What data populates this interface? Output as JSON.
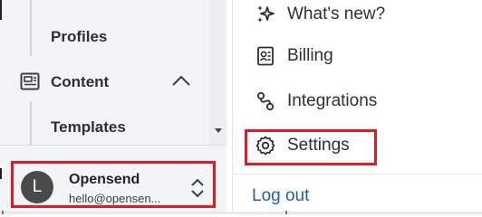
{
  "sidebar": {
    "items": [
      {
        "label": "Profiles",
        "icon": null
      },
      {
        "label": "Content",
        "icon": "content-icon",
        "expanded": true
      },
      {
        "label": "Templates",
        "icon": null
      }
    ],
    "user": {
      "avatar_initial": "L",
      "name": "Opensend",
      "email": "hello@opensen..."
    }
  },
  "menu": {
    "items": [
      {
        "label": "What's new?",
        "icon": "sparkles-icon"
      },
      {
        "label": "Billing",
        "icon": "billing-icon"
      },
      {
        "label": "Integrations",
        "icon": "integrations-icon"
      },
      {
        "label": "Settings",
        "icon": "gear-icon",
        "highlighted": true
      }
    ],
    "logout_label": "Log out"
  },
  "colors": {
    "highlight": "#e01b24",
    "link": "#1f5fa6",
    "sidebar_bg": "#f3f4f6"
  }
}
